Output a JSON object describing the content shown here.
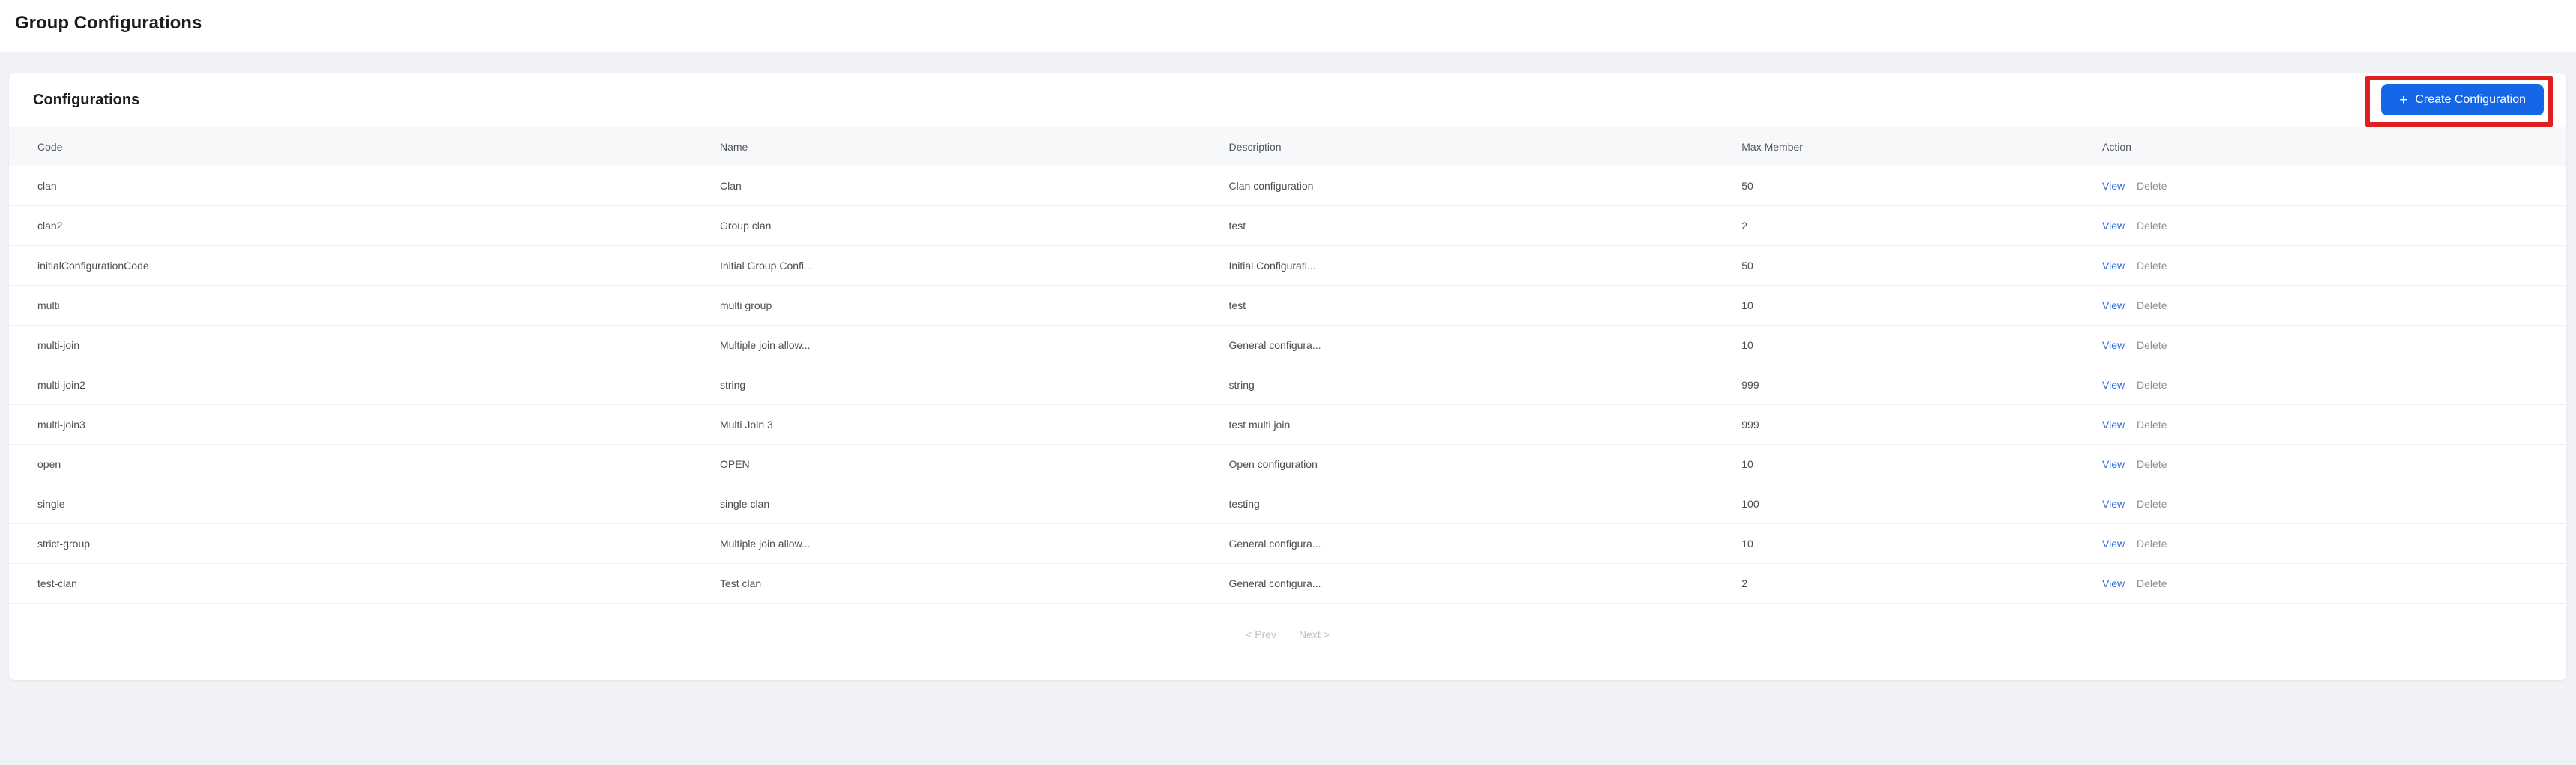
{
  "page": {
    "title": "Group Configurations"
  },
  "card": {
    "title": "Configurations",
    "create_button": {
      "plus": "+",
      "label": "Create Configuration"
    },
    "table": {
      "columns": [
        "Code",
        "Name",
        "Description",
        "Max Member",
        "Action"
      ],
      "actions": {
        "view": "View",
        "delete": "Delete"
      },
      "rows": [
        {
          "code": "clan",
          "name": "Clan",
          "description": "Clan configuration",
          "max_member": "50"
        },
        {
          "code": "clan2",
          "name": "Group clan",
          "description": "test",
          "max_member": "2"
        },
        {
          "code": "initialConfigurationCode",
          "name": "Initial Group Confi...",
          "description": "Initial Configurati...",
          "max_member": "50"
        },
        {
          "code": "multi",
          "name": "multi group",
          "description": "test",
          "max_member": "10"
        },
        {
          "code": "multi-join",
          "name": "Multiple join allow...",
          "description": "General configura...",
          "max_member": "10"
        },
        {
          "code": "multi-join2",
          "name": "string",
          "description": "string",
          "max_member": "999"
        },
        {
          "code": "multi-join3",
          "name": "Multi Join 3",
          "description": "test multi join",
          "max_member": "999"
        },
        {
          "code": "open",
          "name": "OPEN",
          "description": "Open configuration",
          "max_member": "10"
        },
        {
          "code": "single",
          "name": "single clan",
          "description": "testing",
          "max_member": "100"
        },
        {
          "code": "strict-group",
          "name": "Multiple join allow...",
          "description": "General configura...",
          "max_member": "10"
        },
        {
          "code": "test-clan",
          "name": "Test clan",
          "description": "General configura...",
          "max_member": "2"
        }
      ]
    },
    "pagination": {
      "prev": "< Prev",
      "next": "Next >"
    }
  },
  "colors": {
    "button_blue": "#1667e8",
    "link_blue": "#2c6bdf",
    "highlight_red": "#e02020",
    "page_background": "#f0f2f5"
  }
}
